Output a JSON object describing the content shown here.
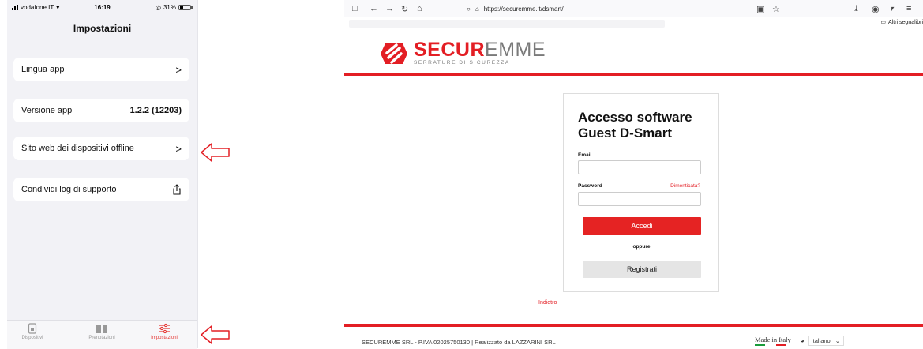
{
  "phone": {
    "status": {
      "carrier": "vodafone IT",
      "time": "16:19",
      "battery": "31%"
    },
    "title": "Impostazioni",
    "rows": [
      {
        "label": "Lingua app",
        "value": "",
        "trailing": ">"
      },
      {
        "label": "Versione app",
        "value": "1.2.2 (12203)",
        "trailing": ""
      },
      {
        "label": "Sito web dei dispositivi offline",
        "value": "",
        "trailing": ">"
      },
      {
        "label": "Condividi log di supporto",
        "value": "",
        "trailing": "share-icon"
      }
    ],
    "tabs": [
      {
        "label": "Dispositivi",
        "icon": "lock-icon",
        "active": false
      },
      {
        "label": "Prenotazioni",
        "icon": "book-icon",
        "active": false
      },
      {
        "label": "Impostazioni",
        "icon": "sliders-icon",
        "active": true
      }
    ],
    "accent_color": "#e53935"
  },
  "browser": {
    "url": "https://securemme.it/dsmart/",
    "bookmarks_other": "Altri segnalibri"
  },
  "site": {
    "logo": {
      "word_red": "SECUR",
      "word_grey": "EMME",
      "tagline": "SERRATURE DI SICUREZZA"
    },
    "brand_color": "#e31e24",
    "login": {
      "title_line1": "Accesso software",
      "title_line2": "Guest D-Smart",
      "email_label": "Email",
      "password_label": "Password",
      "forgot_label": "Dimenticata?",
      "submit_label": "Accedi",
      "or_label": "oppure",
      "register_label": "Registrati"
    },
    "back_link": "Indietro",
    "footer": {
      "text": "SECUREMME SRL - P.IVA 02025750130 | Realizzato da LAZZARINI SRL",
      "made_in": "Made in Italy",
      "language": "Italiano"
    }
  }
}
